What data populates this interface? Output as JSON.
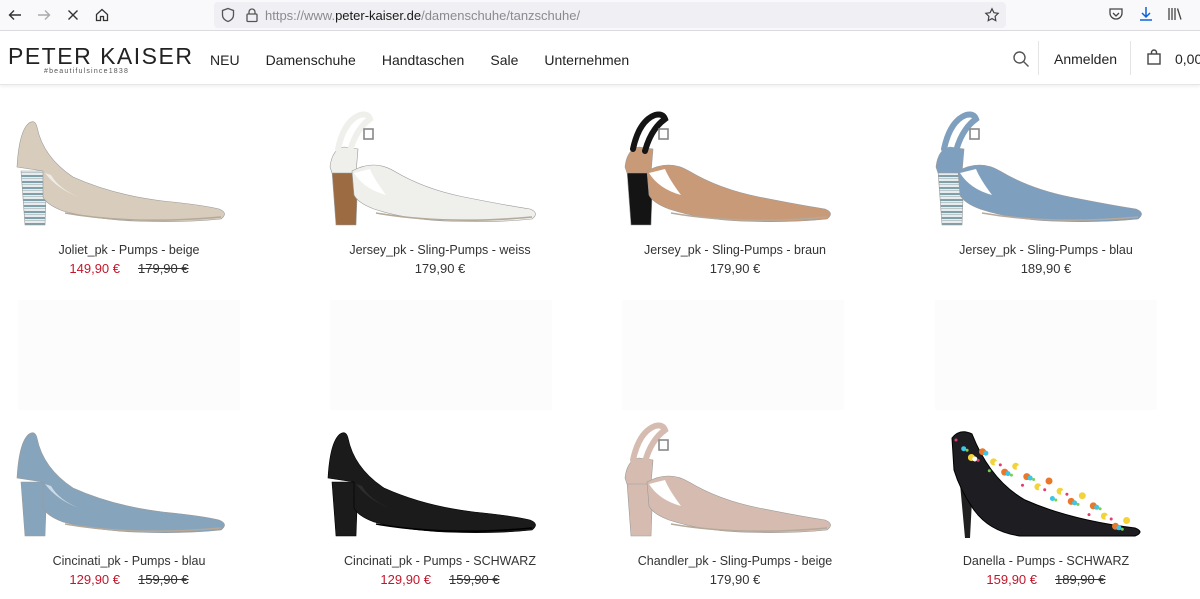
{
  "browser": {
    "url_prefix": "https://www.",
    "url_domain": "peter-kaiser.de",
    "url_path": "/damenschuhe/tanzschuhe/"
  },
  "header": {
    "logo_main": "PETER KAISER",
    "logo_sub": "#beautifulsince1838",
    "nav": [
      "NEU",
      "Damenschuhe",
      "Handtaschen",
      "Sale",
      "Unternehmen"
    ],
    "login": "Anmelden",
    "cart_amount": "0,00"
  },
  "products": [
    {
      "name": "Joliet_pk - Pumps - beige",
      "price": "149,90 €",
      "old_price": "179,90 €",
      "on_sale": true,
      "color": "#d8cdbd",
      "shape": "pump",
      "heel": "striped"
    },
    {
      "name": "Jersey_pk - Sling-Pumps - weiss",
      "price": "179,90 €",
      "old_price": "",
      "on_sale": false,
      "color": "#efefeb",
      "shape": "sling",
      "heel": "wood"
    },
    {
      "name": "Jersey_pk - Sling-Pumps - braun",
      "price": "179,90 €",
      "old_price": "",
      "on_sale": false,
      "color": "#c99a78",
      "shape": "sling",
      "heel": "black"
    },
    {
      "name": "Jersey_pk - Sling-Pumps - blau",
      "price": "189,90 €",
      "old_price": "",
      "on_sale": false,
      "color": "#7f9fbf",
      "shape": "sling",
      "heel": "striped"
    },
    {
      "name": "Cincinati_pk - Pumps - blau",
      "price": "129,90 €",
      "old_price": "159,90 €",
      "on_sale": true,
      "color": "#86a4bc",
      "shape": "pump",
      "heel": "same"
    },
    {
      "name": "Cincinati_pk - Pumps - SCHWARZ",
      "price": "129,90 €",
      "old_price": "159,90 €",
      "on_sale": true,
      "color": "#1b1b1b",
      "shape": "pump",
      "heel": "same"
    },
    {
      "name": "Chandler_pk - Sling-Pumps - beige",
      "price": "179,90 €",
      "old_price": "",
      "on_sale": false,
      "color": "#d6bcb0",
      "shape": "sling",
      "heel": "same"
    },
    {
      "name": "Danella - Pumps - SCHWARZ",
      "price": "159,90 €",
      "old_price": "189,90 €",
      "on_sale": true,
      "color": "#1d1d22",
      "shape": "stiletto",
      "heel": "same"
    }
  ],
  "colors": {
    "sale": "#c2172b"
  }
}
